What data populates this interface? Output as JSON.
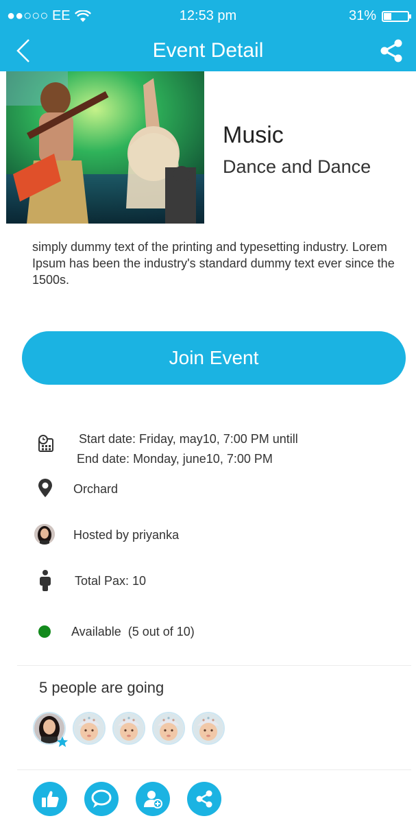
{
  "status_bar": {
    "carrier": "●●○○○ EE",
    "time": "12:53 pm",
    "battery": "31%",
    "battery_level": 0.31
  },
  "nav": {
    "title": "Event Detail",
    "back_icon": "chevron-left-icon",
    "share_icon": "share-icon"
  },
  "event": {
    "category": "Music",
    "subtitle": "Dance and Dance",
    "description": "simply dummy text of the printing and typesetting industry. Lorem Ipsum has been the industry's standard dummy text ever since the 1500s."
  },
  "join_button": "Join Event",
  "details": {
    "start": "Start date: Friday, may10, 7:00 PM untill",
    "end": "End date: Monday, june10, 7:00 PM",
    "location": "Orchard",
    "host": "Hosted by priyanka",
    "pax": "Total Pax: 10",
    "availability": "Available  (5 out of 10)",
    "availability_color": "#138a1c"
  },
  "going": {
    "title": "5 people are going",
    "count": 5
  },
  "actions": [
    {
      "icon": "like-icon"
    },
    {
      "icon": "comment-icon"
    },
    {
      "icon": "add-user-icon"
    },
    {
      "icon": "share-icon"
    }
  ],
  "colors": {
    "accent": "#1bb3e2"
  }
}
